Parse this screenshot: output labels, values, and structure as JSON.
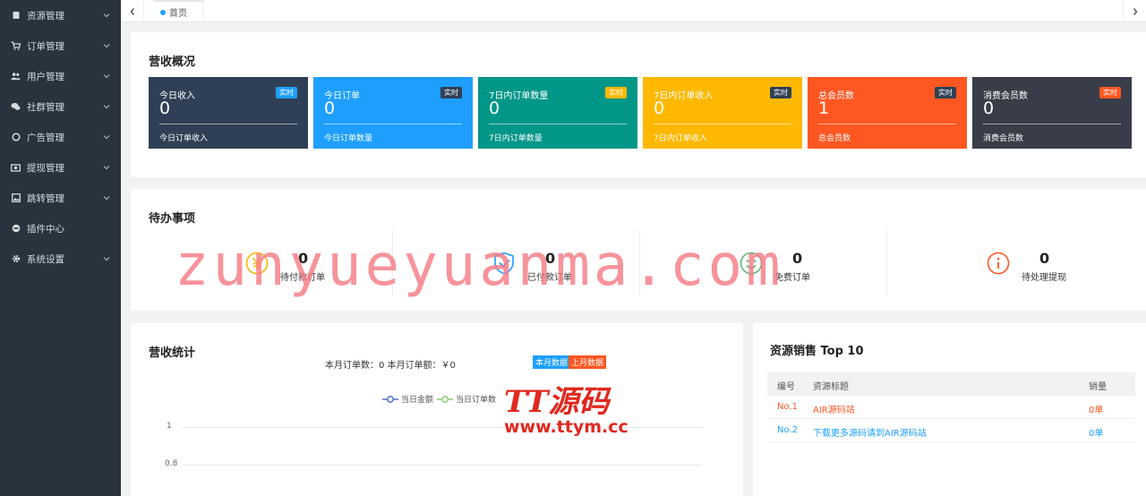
{
  "sidebar": {
    "items": [
      {
        "label": "资源管理",
        "icon": "book-icon"
      },
      {
        "label": "订单管理",
        "icon": "cart-icon"
      },
      {
        "label": "用户管理",
        "icon": "users-icon"
      },
      {
        "label": "社群管理",
        "icon": "chat-icon"
      },
      {
        "label": "广告管理",
        "icon": "circle-icon"
      },
      {
        "label": "提现管理",
        "icon": "money-icon"
      },
      {
        "label": "跳转管理",
        "icon": "image-icon"
      },
      {
        "label": "插件中心",
        "icon": "plugin-icon"
      },
      {
        "label": "系统设置",
        "icon": "gear-icon"
      }
    ]
  },
  "topbar": {
    "home_tab": "首页"
  },
  "overview": {
    "title": "营收概况",
    "cards": [
      {
        "label": "今日收入",
        "badge": "实时",
        "value": "0",
        "footer": "今日订单收入",
        "bg": "#2f4056",
        "badge_bg": "#1e9fff"
      },
      {
        "label": "今日订单",
        "badge": "实时",
        "value": "0",
        "footer": "今日订单数量",
        "bg": "#1e9fff",
        "badge_bg": "#2f4056"
      },
      {
        "label": "7日内订单数量",
        "badge": "实时",
        "value": "0",
        "footer": "7日内订单数量",
        "bg": "#009688",
        "badge_bg": "#ffb800"
      },
      {
        "label": "7日内订单收入",
        "badge": "实时",
        "value": "0",
        "footer": "7日内订单收入",
        "bg": "#ffb800",
        "badge_bg": "#2f4056"
      },
      {
        "label": "总会员数",
        "badge": "实时",
        "value": "1",
        "footer": "总会员数",
        "bg": "#ff5722",
        "badge_bg": "#2f4056"
      },
      {
        "label": "消费会员数",
        "badge": "实时",
        "value": "0",
        "footer": "消费会员数",
        "bg": "#393d49",
        "badge_bg": "#ff5722"
      }
    ]
  },
  "todo": {
    "title": "待办事项",
    "items": [
      {
        "value": "0",
        "label": "待付款订单",
        "icon": "yen-icon",
        "color": "#ffb800"
      },
      {
        "value": "0",
        "label": "已付款订单",
        "icon": "shield-check-icon",
        "color": "#1e9fff"
      },
      {
        "value": "0",
        "label": "免费订单",
        "icon": "smile-icon",
        "color": "#5fb878"
      },
      {
        "value": "0",
        "label": "待处理提现",
        "icon": "info-icon",
        "color": "#ff5722"
      }
    ]
  },
  "revenue": {
    "title": "营收统计",
    "summary": "本月订单数：0   本月订单额：￥0",
    "btn_this_month": "本月数据",
    "btn_last_month": "上月数据",
    "legend_amount": "当日金额",
    "legend_orders": "当日订单数",
    "color_amount": "#5470c6",
    "color_orders": "#91cc75",
    "axis_1": "1",
    "axis_08": "0.8"
  },
  "top10": {
    "title": "资源销售 Top 10",
    "headers": [
      "编号",
      "资源标题",
      "销量"
    ],
    "rows": [
      {
        "no": "No.1",
        "title": "AIR源码站",
        "sales": "0单",
        "color": "#ff5722"
      },
      {
        "no": "No.2",
        "title": "下载更多源码请到AIR源码站",
        "sales": "0单",
        "color": "#1e9fff"
      }
    ]
  },
  "watermark": {
    "text": "zunyueyuanma.com",
    "logo_main": "TT源码",
    "logo_url": "www.ttym.cc"
  }
}
